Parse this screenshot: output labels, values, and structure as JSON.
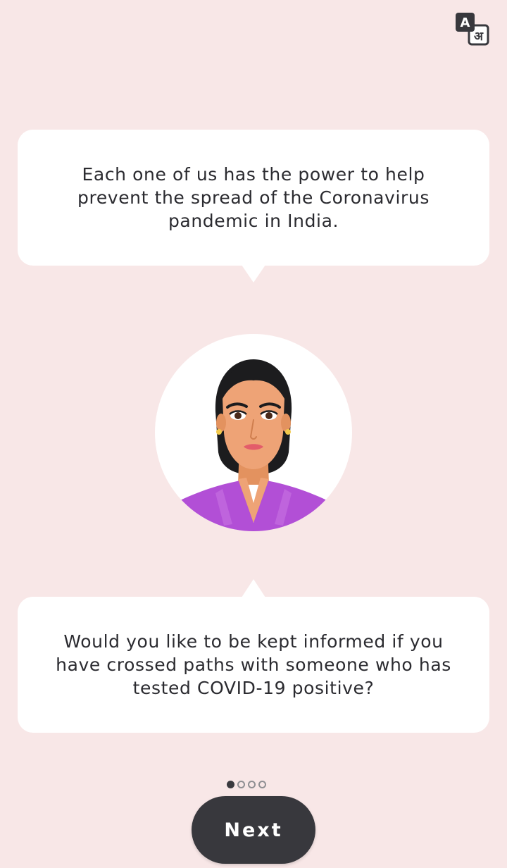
{
  "header": {
    "language_toggle_icon": "translate-icon",
    "language_glyph_latin": "A",
    "language_glyph_devanagari": "अ"
  },
  "intro_message": "Each one of us has the power to help prevent the spread of the Coronavirus pandemic in India.",
  "avatar_icon": "woman-avatar-illustration",
  "question_message": "Would you like to be kept informed if you\nhave crossed paths with someone who has\ntested COVID-19 positive?",
  "pagination": {
    "total": 4,
    "current": 1
  },
  "next_button_label": "Next",
  "colors": {
    "background": "#f8e7e7",
    "bubble": "#ffffff",
    "text": "#2b2b30",
    "button": "#38383d",
    "shirt": "#b24fd6",
    "skin": "#eea376"
  }
}
